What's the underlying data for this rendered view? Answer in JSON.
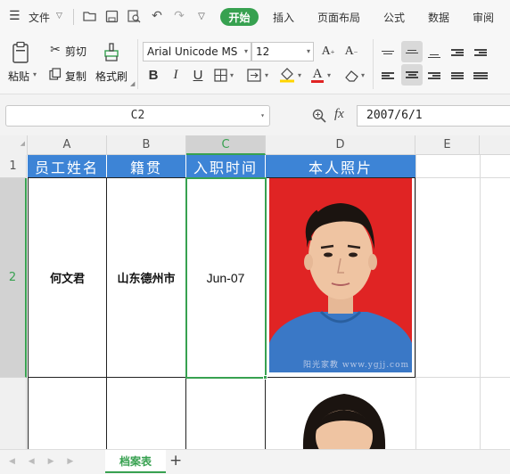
{
  "menubar": {
    "file_label": "文件",
    "tabs": [
      "开始",
      "插入",
      "页面布局",
      "公式",
      "数据",
      "审阅"
    ]
  },
  "ribbon": {
    "paste_label": "粘贴",
    "cut_label": "剪切",
    "copy_label": "复制",
    "format_painter_label": "格式刷",
    "font_name": "Arial Unicode MS",
    "font_size": "12"
  },
  "formula_bar": {
    "name_box": "C2",
    "fx_label": "fx",
    "formula_value": "2007/6/1"
  },
  "sheet": {
    "columns": [
      "A",
      "B",
      "C",
      "D",
      "E"
    ],
    "rows": [
      "1",
      "2"
    ],
    "headers": [
      "员工姓名",
      "籍贯",
      "入职时间",
      "本人照片"
    ],
    "row2": {
      "name": "何文君",
      "origin": "山东德州市",
      "hire_date": "Jun-07"
    },
    "photo_watermark": "阳光家教 www.ygjj.com"
  },
  "sheet_tabs": {
    "active": "档案表",
    "add_label": "+"
  },
  "colors": {
    "accent": "#37a150",
    "header_blue": "#3d84d6",
    "photo_red": "#e02424",
    "shirt_blue": "#3a78c6"
  }
}
